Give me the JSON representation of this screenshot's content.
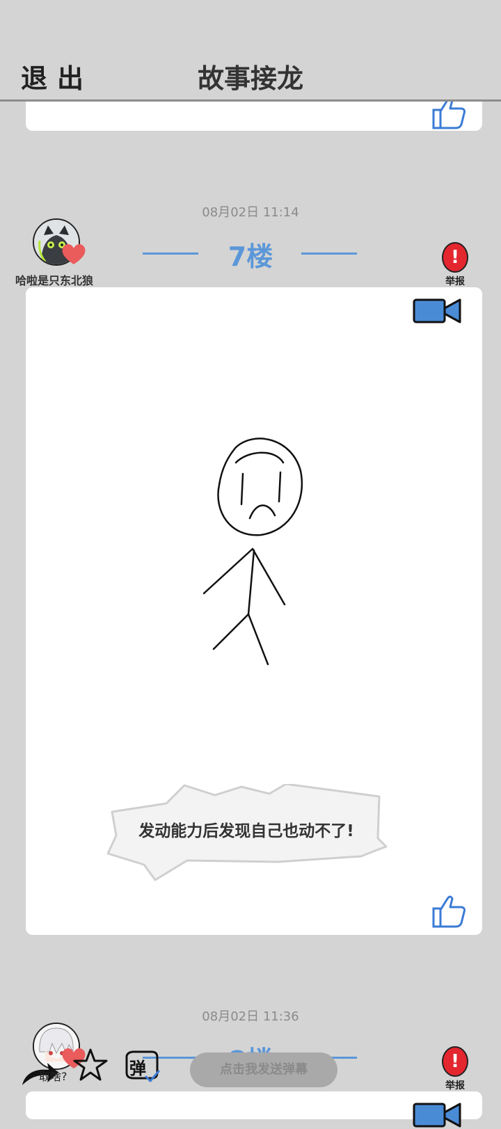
{
  "header": {
    "exit_label": "退出",
    "title": "故事接龙"
  },
  "post7": {
    "timestamp": "08月02日  11:14",
    "floor": "7楼",
    "username": "哈啦是只东北狼",
    "report_label": "举报",
    "caption": "发动能力后发现自己也动不了!"
  },
  "post8": {
    "timestamp": "08月02日  11:36",
    "floor": "8楼",
    "report_label": "举报"
  },
  "bottombar": {
    "quhe_label": "取啥?",
    "danmu_icon_label": "弹",
    "danmu_placeholder": "点击我发送弹幕"
  },
  "colors": {
    "accent": "#5b97d8",
    "report_red": "#e4262f",
    "background": "#d4d4d4"
  }
}
